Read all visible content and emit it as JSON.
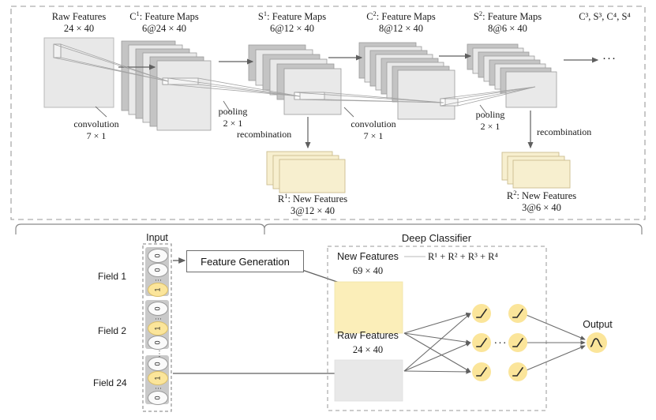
{
  "diagram": {
    "title_semantics": "CNN feature-generation and deep classifier architecture",
    "top_panel": {
      "stages": [
        {
          "name": "raw",
          "title": "Raw Features",
          "subtitle": "24 × 40"
        },
        {
          "name": "c1",
          "title_pre": "C",
          "title_sup": "1",
          "title_post": ": Feature Maps",
          "subtitle": "6@24 × 40"
        },
        {
          "name": "s1",
          "title_pre": "S",
          "title_sup": "1",
          "title_post": ": Feature Maps",
          "subtitle": "6@12 × 40"
        },
        {
          "name": "c2",
          "title_pre": "C",
          "title_sup": "2",
          "title_post": ": Feature Maps",
          "subtitle": "8@12 × 40"
        },
        {
          "name": "s2",
          "title_pre": "S",
          "title_sup": "2",
          "title_post": ": Feature Maps",
          "subtitle": "8@6 × 40"
        }
      ],
      "ellipsis_header": "C³, S³, C⁴, S⁴",
      "ellipsis_glyph": "···",
      "ops": [
        {
          "name": "convolution-1",
          "label": "convolution",
          "size": "7 × 1"
        },
        {
          "name": "pooling-1",
          "label": "pooling",
          "size": "2 × 1"
        },
        {
          "name": "convolution-2",
          "label": "convolution",
          "size": "7 × 1"
        },
        {
          "name": "pooling-2",
          "label": "pooling",
          "size": "2 × 1"
        }
      ],
      "recombination_labels": [
        "recombination",
        "recombination"
      ],
      "new_features": [
        {
          "name": "r1",
          "title_pre": "R",
          "title_sup": "1",
          "title_post": ": New Features",
          "subtitle": "3@12 × 40"
        },
        {
          "name": "r2",
          "title_pre": "R",
          "title_sup": "2",
          "title_post": ": New Features",
          "subtitle": "3@6 × 40"
        }
      ]
    },
    "bottom_panel": {
      "brace_left_label": "Input",
      "brace_right_label": "Deep Classifier",
      "input_label": "Input",
      "fields": [
        {
          "label": "Field 1",
          "cells": [
            "0",
            "0",
            "dots",
            "1"
          ]
        },
        {
          "label": "Field 2",
          "cells": [
            "0",
            "dots",
            "1",
            "0"
          ]
        },
        {
          "label": "Field 24",
          "cells": [
            "0",
            "1",
            "dots",
            "0"
          ]
        }
      ],
      "field_gap_dots": "⋮",
      "feature_generation_label": "Feature Generation",
      "classifier": {
        "panel_title": "Deep Classifier",
        "new_features_label": "New Features",
        "new_features_size": "69 × 40",
        "sum_formula": "R¹ + R² + R³ + R⁴",
        "raw_features_label": "Raw Features",
        "raw_features_size": "24 × 40",
        "hidden_ellipsis": "···",
        "output_label": "Output",
        "neuron_activation_icon": "relu-icon",
        "output_activation_icon": "sigmoid-icon"
      }
    },
    "colors": {
      "map_dark": "#c4c4c4",
      "map_light": "#e9e9e9",
      "new_feature_fill": "#f7efcf",
      "new_feature_stroke": "#cbbd8e",
      "raw_fill": "#e8e8e8",
      "neuron_fill": "#fbe59a",
      "arrow": "#6b6b6b",
      "dash": "#9a9a9a"
    }
  }
}
